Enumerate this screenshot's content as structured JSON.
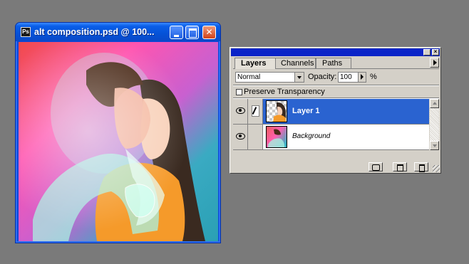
{
  "document_window": {
    "title": "alt composition.psd @ 100...",
    "icon": "photoshop-document-icon",
    "icon_glyph": "Ps",
    "minimize_icon": "minimize-icon",
    "maximize_icon": "maximize-icon",
    "close_icon": "close-icon",
    "close_glyph": "✕"
  },
  "layers_palette": {
    "tabs": [
      {
        "label": "Layers",
        "active": true
      },
      {
        "label": "Channels",
        "active": false
      },
      {
        "label": "Paths",
        "active": false
      }
    ],
    "blend_mode": "Normal",
    "opacity_label": "Opacity:",
    "opacity_value": "100",
    "opacity_unit": "%",
    "preserve_transparency_label": "Preserve Transparency",
    "preserve_transparency_checked": false,
    "layers": [
      {
        "name": "Layer 1",
        "selected": true,
        "visible": true,
        "brush": true
      },
      {
        "name": "Background",
        "selected": false,
        "visible": true,
        "brush": false
      }
    ]
  },
  "colors": {
    "desktop": "#7a7a7a",
    "xp_title_blue": "#0a5ee8",
    "palette_title_blue": "#0a24c8",
    "selected_layer_blue": "#2a63d0"
  }
}
